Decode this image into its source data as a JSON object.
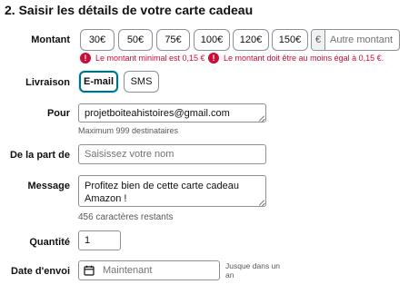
{
  "section": {
    "title": "2. Saisir les détails de votre carte cadeau"
  },
  "amount": {
    "label": "Montant",
    "options": [
      "30€",
      "50€",
      "75€",
      "100€",
      "120€",
      "150€"
    ],
    "currency_symbol": "€",
    "other_placeholder": "Autre montant",
    "errors": [
      "Le montant minimal est 0,15 €",
      "Le montant doit être au moins égal à 0,15 €."
    ]
  },
  "delivery": {
    "label": "Livraison",
    "options": [
      "E-mail",
      "SMS"
    ],
    "selected": "E-mail"
  },
  "recipient": {
    "label": "Pour",
    "value": "projetboiteahistoires@gmail.com",
    "hint": "Maximum 999 destinataires"
  },
  "sender": {
    "label": "De la part de",
    "placeholder": "Saisissez votre nom"
  },
  "message": {
    "label": "Message",
    "value": "Profitez bien de cette carte cadeau\nAmazon !",
    "remaining": "456 caractères restants"
  },
  "quantity": {
    "label": "Quantité",
    "value": "1"
  },
  "send_date": {
    "label": "Date d'envoi",
    "placeholder": "Maintenant",
    "note": "Jusque dans un an"
  },
  "colors": {
    "error": "#cc0c39",
    "selected_border": "#007185",
    "border": "#8d9096"
  },
  "icons": {
    "error": "error-circle-icon",
    "calendar": "calendar-icon",
    "resize": "resize-grip-icon"
  }
}
